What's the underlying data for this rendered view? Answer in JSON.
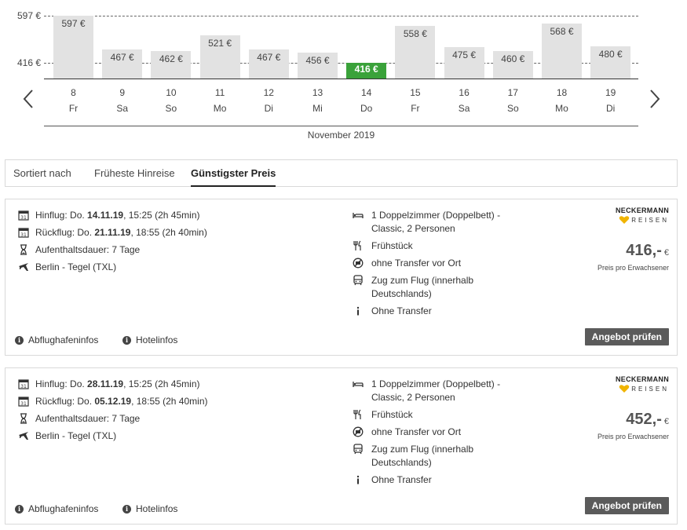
{
  "chart_data": {
    "type": "bar",
    "month_label": "November 2019",
    "y_ticks": [
      {
        "label": "597 €",
        "value": 597
      },
      {
        "label": "416 €",
        "value": 416
      }
    ],
    "bars": [
      {
        "day": "8",
        "weekday": "Fr",
        "label": "597 €",
        "value": 597
      },
      {
        "day": "9",
        "weekday": "Sa",
        "label": "467 €",
        "value": 467
      },
      {
        "day": "10",
        "weekday": "So",
        "label": "462 €",
        "value": 462
      },
      {
        "day": "11",
        "weekday": "Mo",
        "label": "521 €",
        "value": 521
      },
      {
        "day": "12",
        "weekday": "Di",
        "label": "467 €",
        "value": 467
      },
      {
        "day": "13",
        "weekday": "Mi",
        "label": "456 €",
        "value": 456
      },
      {
        "day": "14",
        "weekday": "Do",
        "label": "416 €",
        "value": 416,
        "best": true
      },
      {
        "day": "15",
        "weekday": "Fr",
        "label": "558 €",
        "value": 558
      },
      {
        "day": "16",
        "weekday": "Sa",
        "label": "475 €",
        "value": 475
      },
      {
        "day": "17",
        "weekday": "So",
        "label": "460 €",
        "value": 460
      },
      {
        "day": "18",
        "weekday": "Mo",
        "label": "568 €",
        "value": 568
      },
      {
        "day": "19",
        "weekday": "Di",
        "label": "480 €",
        "value": 480
      }
    ],
    "colors": {
      "bar": "#e2e2e2",
      "best": "#3aa23a"
    }
  },
  "sort": {
    "label": "Sortiert nach",
    "options": [
      "Früheste Hinreise",
      "Günstigster Preis"
    ],
    "active": "Günstigster Preis"
  },
  "offers": [
    {
      "outbound_prefix": "Hinflug: Do. ",
      "outbound_date": "14.11.19",
      "outbound_rest": ", 15:25 (2h 45min)",
      "return_prefix": "Rückflug: Do. ",
      "return_date": "21.11.19",
      "return_rest": ", 18:55 (2h 40min)",
      "duration": "Aufenthaltsdauer: 7 Tage",
      "airport": "Berlin - Tegel (TXL)",
      "room_1": "1 Doppelzimmer (Doppelbett) -",
      "room_2": "Classic, 2 Personen",
      "board": "Frühstück",
      "transfer_place": "ohne Transfer vor Ort",
      "train_1": "Zug zum Flug (innerhalb",
      "train_2": "Deutschlands)",
      "transfer": "Ohne Transfer",
      "operator_top": "NECKERMANN",
      "operator_bottom": "REISEN",
      "price": "416,-",
      "currency": "€",
      "price_note": "Preis pro Erwachsener",
      "cta": "Angebot prüfen",
      "airport_info": "Abflughafeninfos",
      "hotel_info": "Hotelinfos"
    },
    {
      "outbound_prefix": "Hinflug: Do. ",
      "outbound_date": "28.11.19",
      "outbound_rest": ", 15:25 (2h 45min)",
      "return_prefix": "Rückflug: Do. ",
      "return_date": "05.12.19",
      "return_rest": ", 18:55 (2h 40min)",
      "duration": "Aufenthaltsdauer: 7 Tage",
      "airport": "Berlin - Tegel (TXL)",
      "room_1": "1 Doppelzimmer (Doppelbett) -",
      "room_2": "Classic, 2 Personen",
      "board": "Frühstück",
      "transfer_place": "ohne Transfer vor Ort",
      "train_1": "Zug zum Flug (innerhalb",
      "train_2": "Deutschlands)",
      "transfer": "Ohne Transfer",
      "operator_top": "NECKERMANN",
      "operator_bottom": "REISEN",
      "price": "452,-",
      "currency": "€",
      "price_note": "Preis pro Erwachsener",
      "cta": "Angebot prüfen",
      "airport_info": "Abflughafeninfos",
      "hotel_info": "Hotelinfos"
    }
  ],
  "icons": {
    "prev": "chevron-left-icon",
    "next": "chevron-right-icon",
    "calendar": "calendar-icon",
    "hourglass": "hourglass-icon",
    "plane": "plane-icon",
    "bed": "bed-icon",
    "cutlery": "cutlery-icon",
    "no_transfer": "no-transfer-icon",
    "bus": "bus-icon",
    "info": "info-icon",
    "heart": "heart-icon"
  }
}
